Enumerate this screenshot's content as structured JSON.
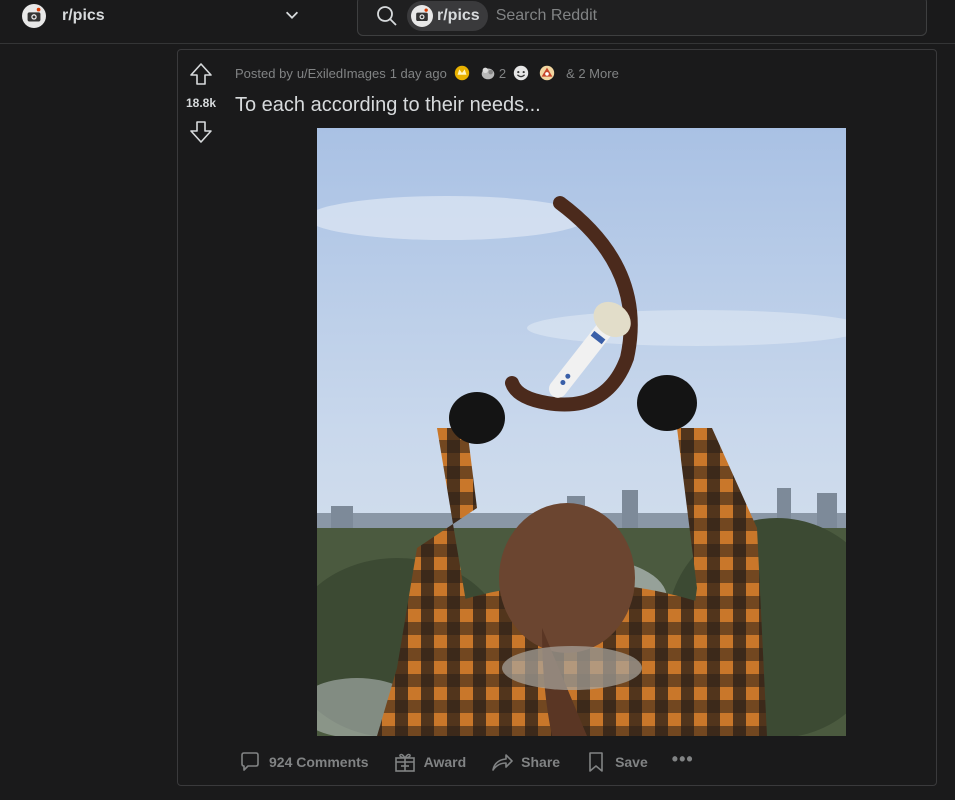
{
  "header": {
    "subreddit": "r/pics",
    "search_chip": "r/pics",
    "search_placeholder": "Search Reddit"
  },
  "post": {
    "posted_by_prefix": "Posted by",
    "author": "u/ExiledImages",
    "age": "1 day ago",
    "awards": [
      {
        "icon": "gold-award-icon",
        "count": ""
      },
      {
        "icon": "silver-award-icon",
        "count": "2"
      },
      {
        "icon": "wholesome-award-icon",
        "count": ""
      },
      {
        "icon": "helpful-award-icon",
        "count": ""
      }
    ],
    "more_awards": "& 2 More",
    "score": "18.8k",
    "title": "To each according to their needs...",
    "actions": {
      "comments": "924 Comments",
      "award": "Award",
      "share": "Share",
      "save": "Save",
      "more": "•••"
    }
  },
  "colors": {
    "background": "#1a1a1b",
    "text": "#d7dadc",
    "muted": "#818384",
    "border": "#3a3a3c"
  }
}
